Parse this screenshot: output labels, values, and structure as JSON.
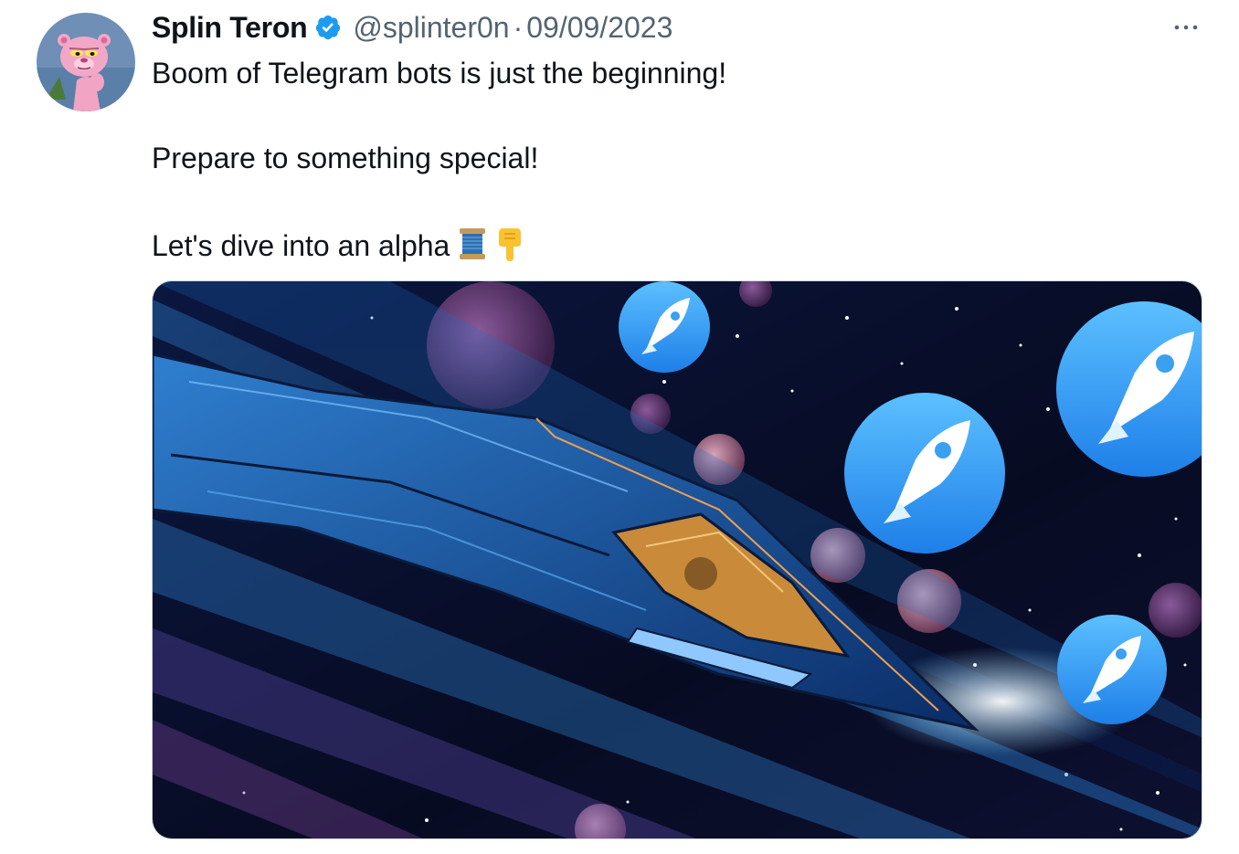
{
  "tweet": {
    "author": {
      "display_name": "Splin Teron",
      "handle": "@splinter0n",
      "verified": true,
      "avatar_icon": "pink-panther-avatar"
    },
    "separator": "·",
    "date": "09/09/2023",
    "lines": [
      "Boom of Telegram bots is just the beginning!",
      "Prepare to something special!",
      "Let's dive into an alpha"
    ],
    "emojis": [
      "spool-of-thread-emoji",
      "backhand-index-pointing-down-emoji"
    ],
    "media": {
      "type": "image",
      "subject_icons": [
        "spaceship-illustration",
        "rocket-app-icon"
      ]
    }
  },
  "colors": {
    "text_primary": "#0f1419",
    "text_secondary": "#536471",
    "verified_blue": "#1d9bf0",
    "rocket_badge_blue": "#2d98f0"
  }
}
